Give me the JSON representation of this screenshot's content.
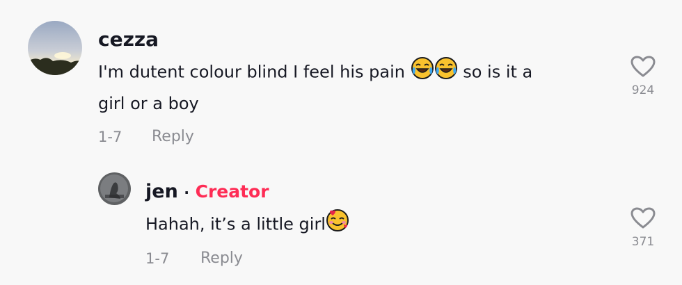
{
  "comments": [
    {
      "username": "cezza",
      "text_before": "I'm dutent colour blind I feel his pain",
      "text_after": "so is it a",
      "text_line2": "girl or a boy",
      "date": "1-7",
      "reply_label": "Reply",
      "likes": "924",
      "emojis": [
        "face-with-tears-of-joy",
        "face-with-tears-of-joy"
      ]
    }
  ],
  "reply": {
    "username": "jen",
    "separator": "·",
    "badge": "Creator",
    "text": "Hahah, it’s a little girl",
    "date": "1-7",
    "reply_label": "Reply",
    "likes": "371",
    "emoji": "smiling-face-with-hearts"
  },
  "colors": {
    "creator_badge": "#fe2c55",
    "meta_text": "#8a8b91",
    "background": "#f8f8f8"
  }
}
